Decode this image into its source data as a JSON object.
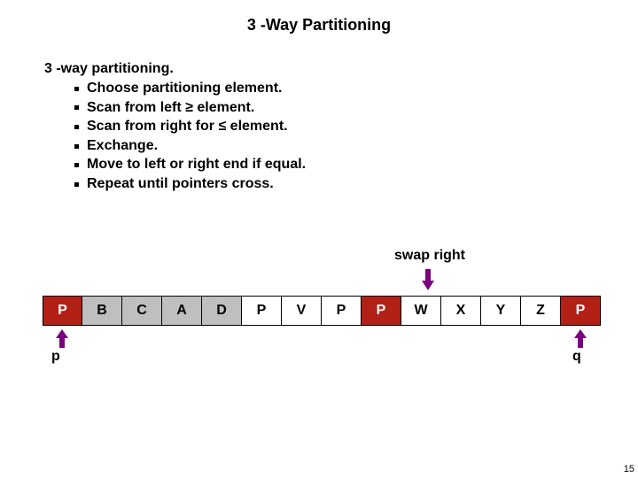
{
  "title": "3 -Way Partitioning",
  "heading": "3 -way partitioning.",
  "bullets": [
    "Choose partitioning element.",
    "Scan from left ≥ element.",
    "Scan from right for ≤  element.",
    "Exchange.",
    "Move to left or right end if equal.",
    "Repeat until pointers cross."
  ],
  "swap_label": "swap right",
  "cells": [
    {
      "value": "P",
      "style": "red"
    },
    {
      "value": "B",
      "style": "gray"
    },
    {
      "value": "C",
      "style": "gray"
    },
    {
      "value": "A",
      "style": "gray"
    },
    {
      "value": "D",
      "style": "gray"
    },
    {
      "value": "P",
      "style": "white"
    },
    {
      "value": "V",
      "style": "white"
    },
    {
      "value": "P",
      "style": "white"
    },
    {
      "value": "P",
      "style": "red"
    },
    {
      "value": "W",
      "style": "white"
    },
    {
      "value": "X",
      "style": "white"
    },
    {
      "value": "Y",
      "style": "white"
    },
    {
      "value": "Z",
      "style": "white"
    },
    {
      "value": "P",
      "style": "red"
    }
  ],
  "pointers": {
    "left": "p",
    "right": "q"
  },
  "page_number": "15"
}
